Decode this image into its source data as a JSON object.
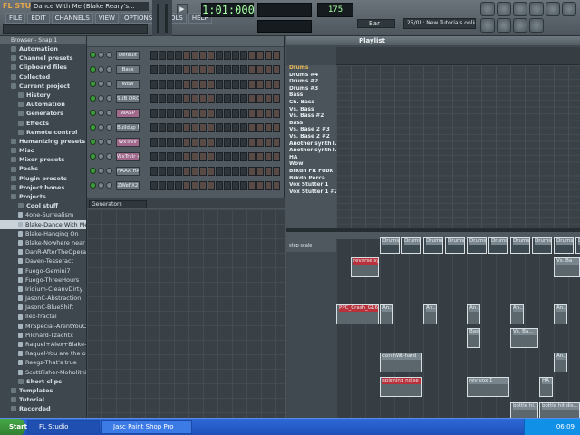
{
  "app": {
    "logo": "FL STUDIO",
    "song_title": "Dance With Me (Blake Reary's..."
  },
  "menu": [
    "FILE",
    "EDIT",
    "CHANNELS",
    "VIEW",
    "OPTIONS",
    "TOOLS",
    "HELP"
  ],
  "transport": {
    "time": "1:01:000",
    "tempo": "175",
    "snap": "Bar",
    "news": "25/01: New Tutorials online"
  },
  "browser": {
    "header": "Browser - Snap 1",
    "items": [
      {
        "label": "Automation",
        "type": "folder",
        "indent": 1
      },
      {
        "label": "Channel presets",
        "type": "folder",
        "indent": 1
      },
      {
        "label": "Clipboard files",
        "type": "folder",
        "indent": 1
      },
      {
        "label": "Collected",
        "type": "folder",
        "indent": 1
      },
      {
        "label": "Current project",
        "type": "folder",
        "indent": 1
      },
      {
        "label": "History",
        "type": "folder",
        "indent": 2
      },
      {
        "label": "Automation",
        "type": "folder",
        "indent": 2
      },
      {
        "label": "Generators",
        "type": "folder",
        "indent": 2
      },
      {
        "label": "Effects",
        "type": "folder",
        "indent": 2
      },
      {
        "label": "Remote control",
        "type": "folder",
        "indent": 2
      },
      {
        "label": "Humanizing presets",
        "type": "folder",
        "indent": 1
      },
      {
        "label": "Misc",
        "type": "folder",
        "indent": 1
      },
      {
        "label": "Mixer presets",
        "type": "folder",
        "indent": 1
      },
      {
        "label": "Packs",
        "type": "folder",
        "indent": 1
      },
      {
        "label": "Plugin presets",
        "type": "folder",
        "indent": 1
      },
      {
        "label": "Project bones",
        "type": "folder",
        "indent": 1
      },
      {
        "label": "Projects",
        "type": "folder",
        "indent": 1
      },
      {
        "label": "Cool stuff",
        "type": "folder",
        "indent": 2
      },
      {
        "label": "4one-Surrealism",
        "type": "file",
        "indent": 2
      },
      {
        "label": "Blake-Dance With Me",
        "type": "file",
        "indent": 2,
        "selected": true
      },
      {
        "label": "Blake-Hanging On",
        "type": "file",
        "indent": 2
      },
      {
        "label": "Blake-Nowhere near",
        "type": "file",
        "indent": 2
      },
      {
        "label": "DanR-AfterTheOperatio",
        "type": "file",
        "indent": 2
      },
      {
        "label": "Daven-Tesseract",
        "type": "file",
        "indent": 2
      },
      {
        "label": "Fuego-Gemini7",
        "type": "file",
        "indent": 2
      },
      {
        "label": "Fuego-ThreeHours",
        "type": "file",
        "indent": 2
      },
      {
        "label": "Iridium-CleanvDirty",
        "type": "file",
        "indent": 2
      },
      {
        "label": "JasonC-Abstraction",
        "type": "file",
        "indent": 2
      },
      {
        "label": "JasonC-BlueShift",
        "type": "file",
        "indent": 2
      },
      {
        "label": "Ilex-fractal",
        "type": "file",
        "indent": 2
      },
      {
        "label": "MrSpecial-ArentYouClev",
        "type": "file",
        "indent": 2
      },
      {
        "label": "Pilchard-Tzachtx",
        "type": "file",
        "indent": 2
      },
      {
        "label": "Raquel+Alex+Blake-My L",
        "type": "file",
        "indent": 2
      },
      {
        "label": "Raquel-You are the one",
        "type": "file",
        "indent": 2
      },
      {
        "label": "Reegz-That's true",
        "type": "file",
        "indent": 2
      },
      {
        "label": "ScottFisher-Moholithic F",
        "type": "file",
        "indent": 2
      },
      {
        "label": "Short clips",
        "type": "folder",
        "indent": 2
      },
      {
        "label": "Templates",
        "type": "folder",
        "indent": 1
      },
      {
        "label": "Tutorial",
        "type": "folder",
        "indent": 1
      },
      {
        "label": "Recorded",
        "type": "folder",
        "indent": 1
      }
    ]
  },
  "stepseq": {
    "channels": [
      "Default",
      "Bass",
      "Wow",
      "SUB DROP",
      "WASP",
      "Buildup Nu...",
      "WxTrvlr",
      "WxTrvlr #2",
      "HAAA HA...",
      "ZWeFX2"
    ],
    "highlighted": [
      4,
      6,
      7
    ],
    "pattern": "Generators"
  },
  "playlist": {
    "title": "Playlist",
    "names": [
      "Drums",
      "Drums #4",
      "Drums #2",
      "Drums #3",
      "Bass",
      "Ch. Bass",
      "Vs. Bass",
      "Vs. Bass #2",
      "Bass",
      "Vs. Base 2 #3",
      "Vs. Base 2 #2",
      "Another synth l...",
      "Another synth l...",
      "HA",
      "Wow",
      "Brkdn Flt Fdbk",
      "Brkdn Perca",
      "Vox Stutter 1",
      "Vox Stutter 1 #2"
    ],
    "categories": [
      0
    ],
    "tools_label": "step  scale",
    "clips": [
      {
        "label": "reverse sy...",
        "col": 1,
        "row": 0,
        "w": 2,
        "red": true
      },
      {
        "label": "PPC_Crash_G16...",
        "col": 0,
        "row": 1,
        "w": 3,
        "red": true
      },
      {
        "label": "An...",
        "col": 3,
        "row": 1,
        "w": 1
      },
      {
        "label": "An...",
        "col": 6,
        "row": 1,
        "w": 1
      },
      {
        "label": "An...",
        "col": 9,
        "row": 1,
        "w": 1
      },
      {
        "label": "An...",
        "col": 12,
        "row": 1,
        "w": 1
      },
      {
        "label": "An...",
        "col": 15,
        "row": 1,
        "w": 1
      },
      {
        "label": "Bass",
        "col": 9,
        "row": 2,
        "w": 1
      },
      {
        "label": "Vs. Ba...",
        "col": 12,
        "row": 2,
        "w": 2
      },
      {
        "label": "corshWt-hard",
        "col": 3,
        "row": 3,
        "w": 3
      },
      {
        "label": "spinning noise",
        "col": 3,
        "row": 4,
        "w": 3,
        "red": true
      },
      {
        "label": "rev vox 1",
        "col": 9,
        "row": 4,
        "w": 3
      },
      {
        "label": "HA",
        "col": 14,
        "row": 4,
        "w": 1
      },
      {
        "label": "bottle hi...",
        "col": 12,
        "row": 5,
        "w": 2
      },
      {
        "label": "bottle hit dis...",
        "col": 14,
        "row": 5,
        "w": 3
      },
      {
        "label": "Vs. Ba",
        "col": 15,
        "row": 0,
        "w": 2
      },
      {
        "label": "An...",
        "col": 15,
        "row": 3,
        "w": 1
      }
    ],
    "top_labels": [
      "Drums",
      "Drums",
      "Drums",
      "Drums",
      "Drums",
      "Drums",
      "Drums",
      "Drums",
      "Drums",
      "Drums"
    ]
  },
  "taskbar": {
    "start": "Start",
    "tasks": [
      "FL Studio",
      "Jasc Paint Shop Pro"
    ],
    "clock": "06:09"
  }
}
